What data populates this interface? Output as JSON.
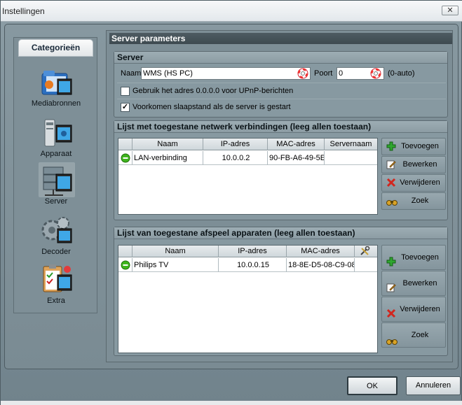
{
  "window": {
    "title": "Instellingen",
    "close": "✕"
  },
  "sidebar": {
    "header": "Categorieën",
    "items": [
      {
        "label": "Mediabronnen",
        "icon": "media-folder-icon"
      },
      {
        "label": "Apparaat",
        "icon": "device-icon"
      },
      {
        "label": "Server",
        "icon": "server-icon",
        "selected": true
      },
      {
        "label": "Decoder",
        "icon": "decoder-gear-icon"
      },
      {
        "label": "Extra",
        "icon": "extra-clipboard-icon"
      }
    ]
  },
  "main": {
    "header": "Server parameters",
    "server": {
      "title": "Server",
      "name_label": "Naam",
      "name_value": "WMS (HS PC)",
      "port_label": "Poort",
      "port_value": "0",
      "port_hint": "(0-auto)",
      "check1_label": "Gebruik het adres 0.0.0.0 voor UPnP-berichten",
      "check1_checked": false,
      "check2_label": "Voorkomen  slaapstand als de server is gestart",
      "check2_checked": true,
      "check2_mark": "✓"
    },
    "network": {
      "title": "Lijst met toegestane netwerk verbindingen (leeg allen toestaan)",
      "columns": [
        "Naam",
        "IP-adres",
        "MAC-adres",
        "Servernaam"
      ],
      "rows": [
        {
          "name": "LAN-verbinding",
          "ip": "10.0.0.2",
          "mac": "90-FB-A6-49-5E",
          "server": ""
        }
      ],
      "buttons": {
        "add": "Toevoegen",
        "edit": "Bewerken",
        "delete": "Verwijderen",
        "search": "Zoek"
      }
    },
    "devices": {
      "title": "Lijst van toegestane afspeel apparaten (leeg allen toestaan)",
      "columns": [
        "Naam",
        "IP-adres",
        "MAC-adres"
      ],
      "rows": [
        {
          "name": "Philips TV",
          "ip": "10.0.0.15",
          "mac": "18-8E-D5-08-C9-08"
        }
      ],
      "buttons": {
        "add": "Toevoegen",
        "edit": "Bewerken",
        "delete": "Verwijderen",
        "search": "Zoek"
      }
    }
  },
  "footer": {
    "ok": "OK",
    "cancel": "Annuleren"
  },
  "colors": {
    "accent_header": "#3e4a50",
    "panel": "#7d8e96",
    "status_green": "#3fb51d"
  }
}
